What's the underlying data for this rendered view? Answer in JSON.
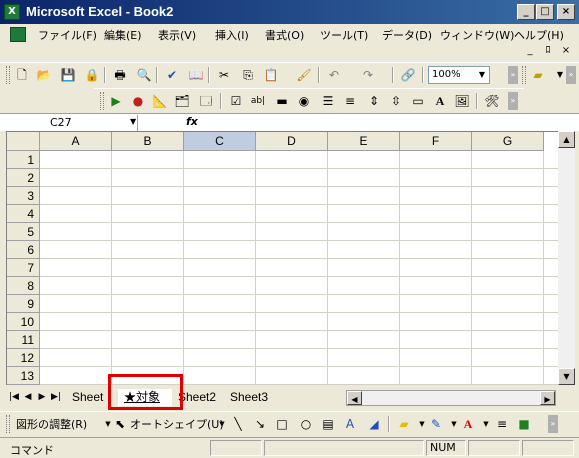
{
  "window": {
    "title": "Microsoft Excel - Book2",
    "app_icon_letter": "X",
    "controls": [
      "_",
      "□",
      "×"
    ]
  },
  "menubar": {
    "items": [
      "ファイル(F)",
      "編集(E)",
      "表示(V)",
      "挿入(I)",
      "書式(O)",
      "ツール(T)",
      "データ(D)",
      "ウィンドウ(W)",
      "ヘルプ(H)"
    ],
    "doc_controls": [
      "_",
      "ﾛ",
      "×"
    ]
  },
  "toolbar": {
    "zoom": "100%"
  },
  "formula_bar": {
    "name_box": "C27",
    "fx_label": "fx",
    "formula": ""
  },
  "grid": {
    "columns": [
      "A",
      "B",
      "C",
      "D",
      "E",
      "F",
      "G"
    ],
    "active_column": "C",
    "rows": [
      "1",
      "2",
      "3",
      "4",
      "5",
      "6",
      "7",
      "8",
      "9",
      "10",
      "11",
      "12",
      "13"
    ]
  },
  "sheet_tabs": {
    "tabs": [
      "Sheet",
      "★対象",
      "Sheet2",
      "Sheet3"
    ],
    "active": "★対象"
  },
  "drawing_toolbar": {
    "draw_label": "図形の調整(R)",
    "autoshape_label": "オートシェイプ(U)"
  },
  "status_bar": {
    "mode": "コマンド",
    "num": "NUM"
  },
  "colors": {
    "title_bar": "#0A246A",
    "highlight_box": "#E00000",
    "active_column_header": "#C0CDE0"
  }
}
